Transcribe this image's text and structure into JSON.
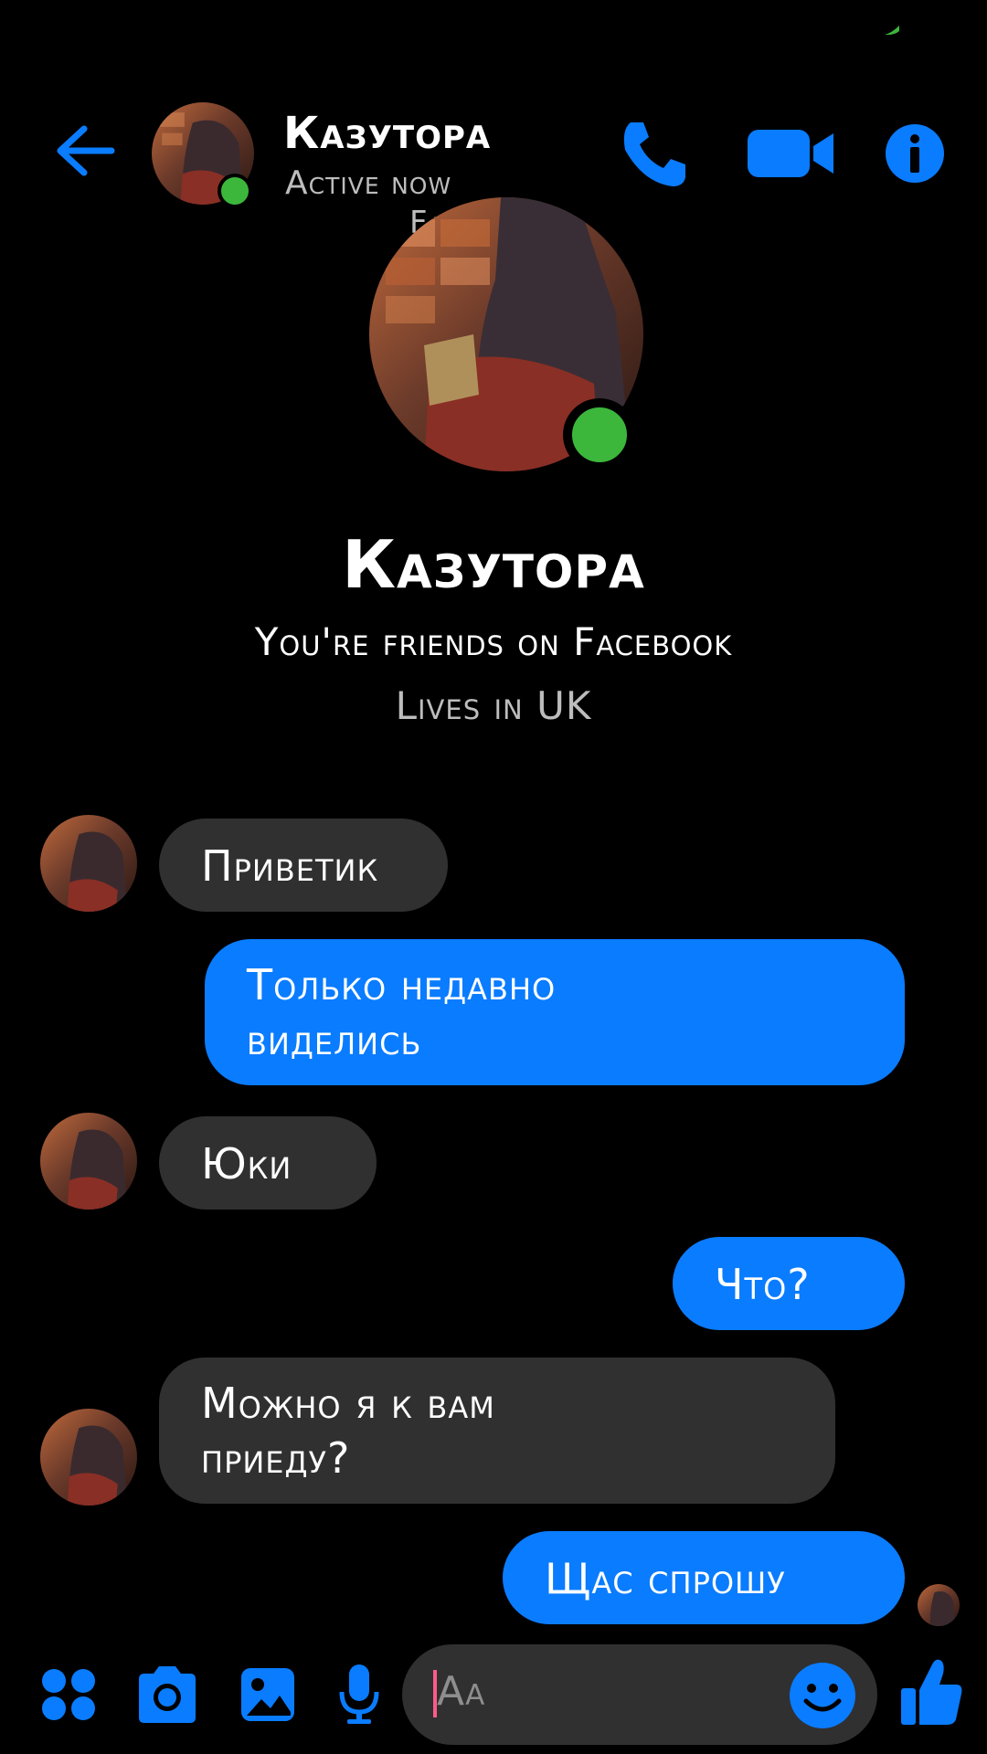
{
  "colors": {
    "accent": "#0a7cff",
    "online": "#3cb73c",
    "incoming_bubble": "#303030"
  },
  "header": {
    "name": "Казутора",
    "status": "Active now",
    "watermark": "FakeChat",
    "icons": [
      "back-arrow-icon",
      "phone-icon",
      "video-camera-icon",
      "info-icon"
    ]
  },
  "profile": {
    "name": "Казутора",
    "friends_text": "You're friends on Facebook",
    "location_text": "Lives in UK"
  },
  "messages": [
    {
      "direction": "incoming",
      "lines": [
        "Приветик"
      ]
    },
    {
      "direction": "outgoing",
      "lines": [
        "Только недавно",
        "виделись"
      ]
    },
    {
      "direction": "incoming",
      "lines": [
        "Юки"
      ]
    },
    {
      "direction": "outgoing",
      "lines": [
        "Что?"
      ]
    },
    {
      "direction": "incoming",
      "lines": [
        "Можно я к вам",
        "приеду?"
      ]
    },
    {
      "direction": "outgoing",
      "lines": [
        "Щас спрошу"
      ]
    }
  ],
  "composer": {
    "placeholder": "Aa",
    "icons": [
      "apps-icon",
      "camera-icon",
      "gallery-icon",
      "microphone-icon",
      "emoji-icon",
      "thumbs-up-icon"
    ]
  }
}
